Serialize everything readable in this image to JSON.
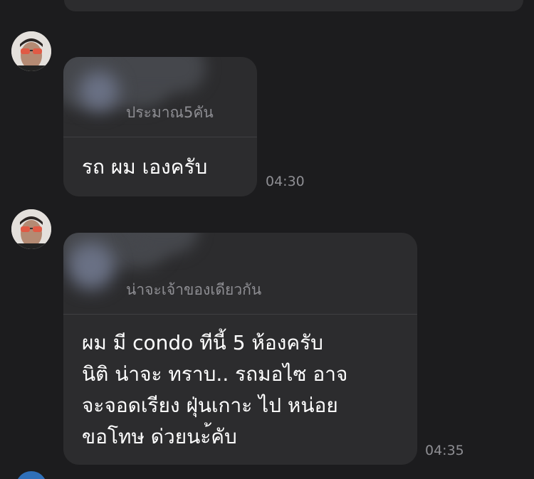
{
  "messages": [
    {
      "quoted_text": "ประมาณ5คัน",
      "lines": [
        "รถ ผม เองครับ"
      ],
      "time": "04:30"
    },
    {
      "quoted_text": "น่าจะเจ้าของเดียวกัน",
      "lines": [
        "ผม มี condo ทีนี้ 5 ห้องครับ",
        "นิติ น่าจะ ทราบ.. รถมอไซ อาจ",
        "จะจอดเรียง ฝุ่นเกาะ ไป หน่อย",
        "ขอโทษ ด่วยนะ้คับ"
      ],
      "time": "04:35"
    }
  ],
  "icons": {
    "avatar": "sender-avatar-with-red-sunglasses",
    "bottom_avatar": "blue-avatar"
  },
  "colors": {
    "background": "#1c1c1e",
    "bubble": "#2c2c2e",
    "secondary_text": "#8e8e93"
  }
}
